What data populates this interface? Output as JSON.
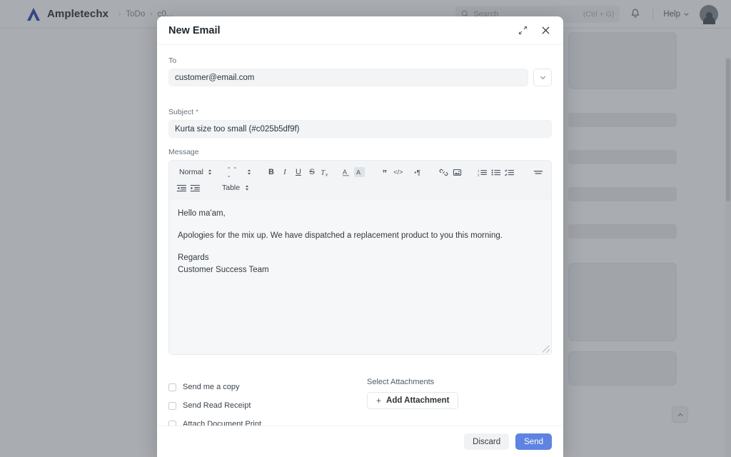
{
  "app": {
    "brand_name": "Ampletechx",
    "breadcrumb": [
      "ToDo",
      "c0..."
    ],
    "search_placeholder": "Search",
    "search_shortcut": "(Ctrl + G)",
    "help_label": "Help"
  },
  "modal": {
    "title": "New Email",
    "expand_icon": "expand-diagonal-icon",
    "close_icon": "close-icon",
    "to": {
      "label": "To",
      "value": "customer@email.com",
      "dropdown_icon": "chevron-down-icon"
    },
    "subject": {
      "label": "Subject",
      "required_marker": "*",
      "value": "Kurta size too small (#c025b5df9f)"
    },
    "message": {
      "label": "Message",
      "paragraphs": [
        "Hello ma'am,",
        "Apologies for the mix up. We have dispatched a replacement product to you this morning.",
        "Regards",
        "Customer Success Team"
      ]
    },
    "toolbar": {
      "style_label": "Normal",
      "table_label": "Table",
      "dots_label": "- - -",
      "items": [
        {
          "name": "bold-icon",
          "glyph": "B"
        },
        {
          "name": "italic-icon",
          "glyph": "I"
        },
        {
          "name": "underline-icon",
          "glyph": "U"
        },
        {
          "name": "strikethrough-icon",
          "glyph": "S"
        },
        {
          "name": "clear-format-icon",
          "glyph": "Tx"
        },
        {
          "name": "font-color-icon",
          "glyph": "A"
        },
        {
          "name": "highlight-color-icon",
          "glyph": "A"
        },
        {
          "name": "blockquote-icon",
          "glyph": "”"
        },
        {
          "name": "code-block-icon",
          "glyph": "</>"
        },
        {
          "name": "text-direction-icon",
          "glyph": "¶"
        },
        {
          "name": "link-icon",
          "glyph": "link"
        },
        {
          "name": "image-icon",
          "glyph": "image"
        },
        {
          "name": "ordered-list-icon",
          "glyph": "1."
        },
        {
          "name": "bullet-list-icon",
          "glyph": "•"
        },
        {
          "name": "checklist-icon",
          "glyph": "✓"
        },
        {
          "name": "align-icon",
          "glyph": "align"
        },
        {
          "name": "outdent-icon",
          "glyph": "←"
        },
        {
          "name": "indent-icon",
          "glyph": "→"
        }
      ]
    },
    "options": [
      {
        "label": "Send me a copy",
        "checked": false
      },
      {
        "label": "Send Read Receipt",
        "checked": false
      },
      {
        "label": "Attach Document Print",
        "checked": false
      }
    ],
    "attachments": {
      "label": "Select Attachments",
      "button_label": "Add Attachment",
      "plus": "+"
    },
    "footer": {
      "discard_label": "Discard",
      "send_label": "Send"
    }
  },
  "colors": {
    "primary": "#5e83e0",
    "overlay": "#484f57",
    "text": "#1f272e",
    "muted": "#64707c",
    "field_bg": "#f3f4f6"
  }
}
